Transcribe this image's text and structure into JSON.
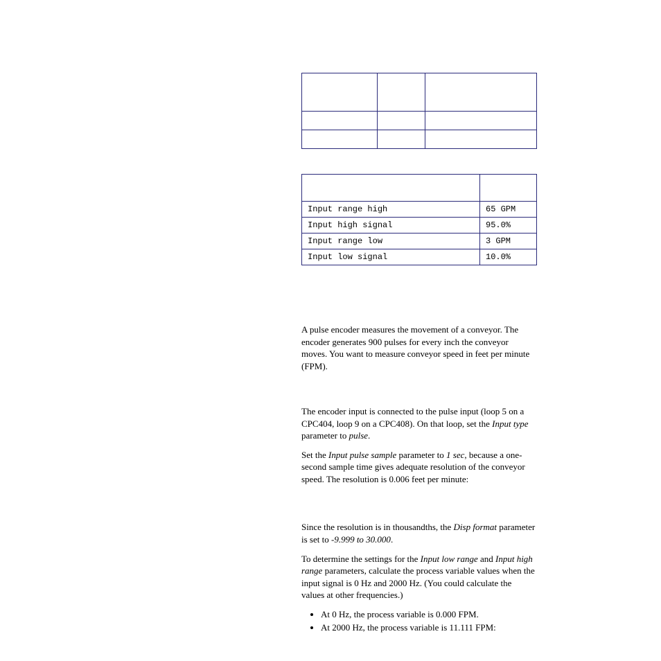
{
  "table1": {
    "rows": [
      [
        "",
        "",
        ""
      ],
      [
        "",
        "",
        ""
      ],
      [
        "",
        "",
        ""
      ]
    ]
  },
  "table2": {
    "headers": [
      "",
      ""
    ],
    "rows": [
      [
        "Input range high",
        "65 GPM"
      ],
      [
        "Input high signal",
        "95.0%"
      ],
      [
        "Input range low",
        "3 GPM"
      ],
      [
        "Input low signal",
        "10.0%"
      ]
    ]
  },
  "para1": "A pulse encoder measures the movement of a conveyor. The encoder generates 900 pulses for every inch the conveyor moves. You want to measure conveyor speed in feet per minute (FPM).",
  "para2_a": "The encoder input is connected to the pulse input (loop 5 on a CPC404, loop 9 on a CPC408). On that loop, set the ",
  "para2_em1": "Input type",
  "para2_b": " parameter to ",
  "para2_em2": "pulse",
  "para2_c": ".",
  "para3_a": "Set the ",
  "para3_em1": "Input pulse sample",
  "para3_b": " parameter to ",
  "para3_em2": "1 sec",
  "para3_c": ", because a one-second sample time gives adequate resolution of the conveyor speed. The resolution is 0.006 feet per minute:",
  "para4_a": "Since the resolution is in thousandths, the ",
  "para4_em1": "Disp format",
  "para4_b": " parameter is set to ",
  "para4_em2": "-9.999 to 30.000",
  "para4_c": ".",
  "para5_a": "To determine the settings for the ",
  "para5_em1": "Input low range",
  "para5_b": " and ",
  "para5_em2": "Input high range",
  "para5_c": " parameters, calculate the process variable values when the input signal is 0 Hz and 2000 Hz. (You could calculate the values at other frequencies.)",
  "bullet1": "At 0 Hz, the process variable is 0.000 FPM.",
  "bullet2": "At 2000 Hz, the process variable is 11.111 FPM:"
}
